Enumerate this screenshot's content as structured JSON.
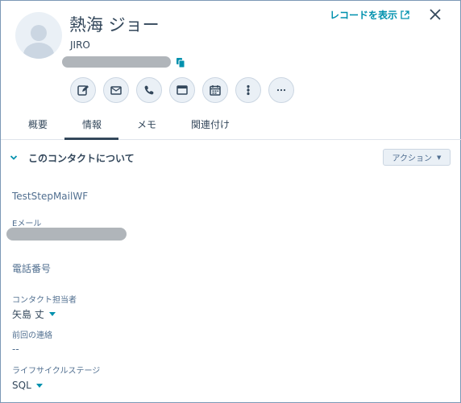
{
  "header": {
    "name": "熱海 ジョー",
    "subname": "JIRO",
    "record_link": "レコードを表示"
  },
  "actions": [
    {
      "icon": "edit-icon",
      "name": "note-action-button"
    },
    {
      "icon": "email-icon",
      "name": "email-action-button"
    },
    {
      "icon": "phone-icon",
      "name": "call-action-button"
    },
    {
      "icon": "window-icon",
      "name": "task-action-button"
    },
    {
      "icon": "calendar-icon",
      "name": "meeting-action-button"
    },
    {
      "icon": "more-vertical-icon",
      "name": "activity-action-button"
    },
    {
      "icon": "more-horizontal-icon",
      "name": "more-action-button"
    }
  ],
  "tabs": {
    "overview": "概要",
    "info": "情報",
    "memo": "メモ",
    "related": "関連付け",
    "active": "info"
  },
  "section": {
    "title": "このコンタクトについて",
    "action_label": "アクション"
  },
  "fields": {
    "top_value": "TestStepMailWF",
    "email_label": "Eメール",
    "phone_label": "電話番号",
    "owner_label": "コンタクト担当者",
    "owner_value": "矢島 丈",
    "last_contact_label": "前回の連絡",
    "last_contact_value": "--",
    "lifecycle_label": "ライフサイクルステージ",
    "lifecycle_value": "SQL"
  },
  "colors": {
    "accent": "#0091ae",
    "text": "#33475b",
    "border": "#cbd6e2"
  }
}
